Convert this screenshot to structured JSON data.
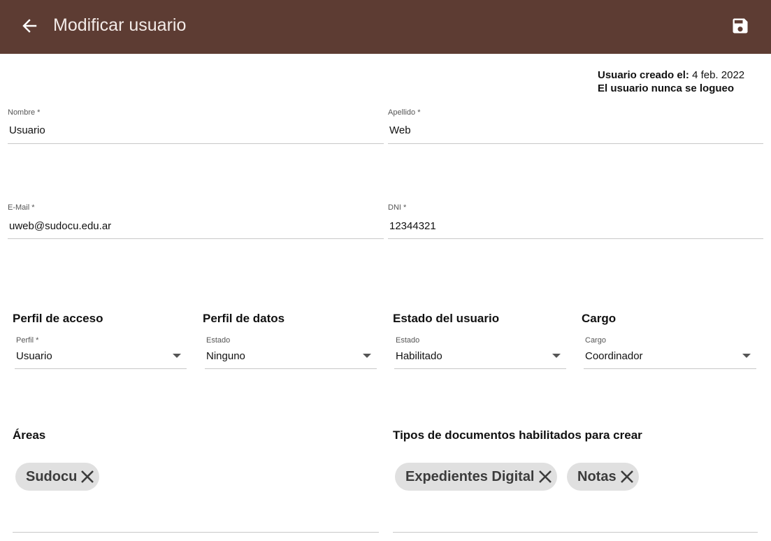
{
  "header": {
    "title": "Modificar usuario",
    "back_icon": "arrow-left-icon",
    "save_icon": "save-icon",
    "bg_color": "#5d3c33"
  },
  "meta": {
    "created_label": "Usuario creado el:",
    "created_value": "4 feb. 2022",
    "login_status": "El usuario nunca se logueo"
  },
  "form": {
    "nombre": {
      "label": "Nombre *",
      "value": "Usuario"
    },
    "apellido": {
      "label": "Apellido *",
      "value": "Web"
    },
    "email": {
      "label": "E-Mail *",
      "value": "uweb@sudocu.edu.ar"
    },
    "dni": {
      "label": "DNI *",
      "value": "12344321"
    }
  },
  "sections": {
    "perfil_acceso": {
      "heading": "Perfil de acceso",
      "label": "Perfil *",
      "value": "Usuario"
    },
    "perfil_datos": {
      "heading": "Perfil de datos",
      "label": "Estado",
      "value": "Ninguno"
    },
    "estado_usuario": {
      "heading": "Estado del usuario",
      "label": "Estado",
      "value": "Habilitado"
    },
    "cargo": {
      "heading": "Cargo",
      "label": "Cargo",
      "value": "Coordinador"
    }
  },
  "areas": {
    "heading": "Áreas",
    "chips": [
      "Sudocu"
    ]
  },
  "tipos_documentos": {
    "heading": "Tipos de documentos habilitados para crear",
    "chips": [
      "Expedientes Digital",
      "Notas"
    ]
  }
}
